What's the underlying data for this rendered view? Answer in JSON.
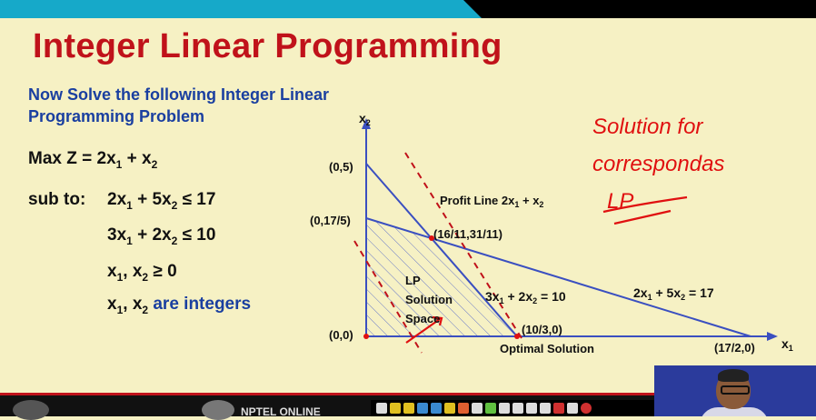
{
  "slide": {
    "title": "Integer Linear Programming",
    "intro": "Now Solve the following Integer Linear Programming  Problem",
    "objective": {
      "lead": "Max Z = 2x",
      "s1": "1",
      "mid": " + x",
      "s2": "2"
    },
    "sub_to_label": "sub to:",
    "c1": {
      "a": "2x",
      "s1": "1",
      "b": " + 5x",
      "s2": "2",
      "c": " ≤ 17"
    },
    "c2": {
      "a": "3x",
      "s1": "1",
      "b": " + 2x",
      "s2": "2",
      "c": " ≤ 10"
    },
    "c3": {
      "a": "x",
      "s1": "1",
      "b": ", x",
      "s2": "2",
      "c": " ≥ 0"
    },
    "c4": {
      "a": "x",
      "s1": "1",
      "b": ", x",
      "s2": "2",
      "c": " are integers"
    }
  },
  "graph": {
    "x_axis_label": "x",
    "x_axis_sub": "1",
    "y_axis_label": "x",
    "y_axis_sub": "2",
    "pt_05": "(0,5)",
    "pt_0175": "(0,17/5)",
    "pt_00": "(0,0)",
    "pt_int": "(16/11,31/11)",
    "pt_1030": "(10/3,0)",
    "pt_1720": "(17/2,0)",
    "profit_line": "Profit Line 2x",
    "profit_sub1": "1",
    "profit_plus": " + x",
    "profit_sub2": "2",
    "eq1": "3x",
    "eq1_s1": "1",
    "eq1_b": " + 2x",
    "eq1_s2": "2",
    "eq1_c": " = 10",
    "eq2": "2x",
    "eq2_s1": "1",
    "eq2_b": " + 5x",
    "eq2_s2": "2",
    "eq2_c": " = 17",
    "lp1": "LP",
    "lp2": "Solution",
    "lp3": "Space",
    "optimal": "Optimal Solution"
  },
  "annotation": {
    "line1": "Solution for",
    "line2": "correspondas",
    "line3": "LP"
  },
  "footer": {
    "brand": "NPTEL ONLINE"
  },
  "colors": {
    "title": "#c0121a",
    "intro": "#1a3fa0",
    "axis": "#3a4fc0",
    "dashed": "#c0121a",
    "ink": "#e01010",
    "background": "#f6f1c4"
  }
}
